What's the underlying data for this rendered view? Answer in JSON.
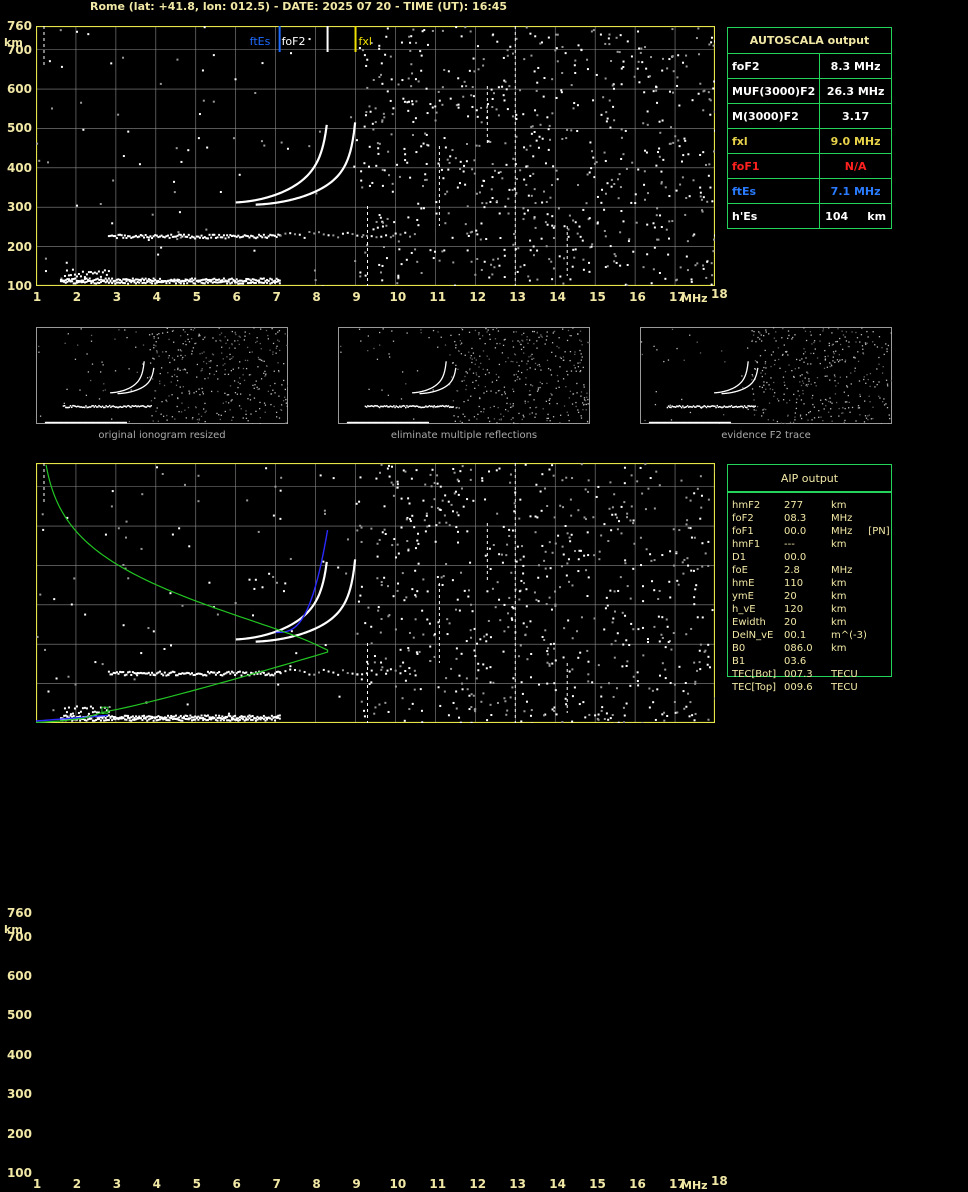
{
  "title": "Rome (lat: +41.8, lon: 012.5) - DATE: 2025 07 20 - TIME (UT): 16:45",
  "axes": {
    "y_unit": "km",
    "x_unit": "MHz",
    "y_ticks": [
      "760",
      "700",
      "600",
      "500",
      "400",
      "300",
      "200",
      "100"
    ],
    "x_ticks": [
      "1",
      "2",
      "3",
      "4",
      "5",
      "6",
      "7",
      "8",
      "9",
      "10",
      "11",
      "12",
      "13",
      "14",
      "15",
      "16",
      "17",
      "18"
    ]
  },
  "markers": {
    "ftEs": "ftEs",
    "foF2": "foF2",
    "fxl": "fxl",
    "ftEs_color": "#1e6bff",
    "foF2_color": "#ffffff",
    "fxl_color": "#f0e000"
  },
  "thumbnails": [
    {
      "caption": "original ionogram resized"
    },
    {
      "caption": "eliminate multiple reflections"
    },
    {
      "caption": "evidence F2 trace"
    }
  ],
  "autoscala": {
    "header": "AUTOSCALA output",
    "rows": [
      {
        "label": "foF2",
        "value": "8.3 MHz",
        "color": "#ffffff"
      },
      {
        "label": "MUF(3000)F2",
        "value": "26.3 MHz",
        "color": "#ffffff"
      },
      {
        "label": "M(3000)F2",
        "value": "3.17",
        "color": "#ffffff"
      },
      {
        "label": "fxl",
        "value": "9.0 MHz",
        "color": "#e8d24a"
      },
      {
        "label": "foF1",
        "value": "N/A",
        "color": "#ff2020"
      },
      {
        "label": "ftEs",
        "value": "7.1 MHz",
        "color": "#2a7bff"
      },
      {
        "label": "h'Es",
        "value": "104     km",
        "color": "#ffffff"
      }
    ]
  },
  "aip": {
    "header": "AIP output",
    "rows": [
      {
        "name": "hmF2",
        "value": "277",
        "unit": "km"
      },
      {
        "name": "foF2",
        "value": "08.3",
        "unit": "MHz"
      },
      {
        "name": "foF1",
        "value": "00.0",
        "unit": "MHz     [PN]"
      },
      {
        "name": "hmF1",
        "value": "---",
        "unit": "km"
      },
      {
        "name": "D1",
        "value": "00.0",
        "unit": ""
      },
      {
        "name": "foE",
        "value": "2.8",
        "unit": "MHz"
      },
      {
        "name": "hmE",
        "value": "110",
        "unit": "km"
      },
      {
        "name": "ymE",
        "value": "20",
        "unit": "km"
      },
      {
        "name": "h_vE",
        "value": "120",
        "unit": "km"
      },
      {
        "name": "Ewidth",
        "value": "20",
        "unit": "km"
      },
      {
        "name": "DelN_vE",
        "value": "00.1",
        "unit": "m^(-3)"
      },
      {
        "name": "B0",
        "value": "086.0",
        "unit": "km"
      },
      {
        "name": "B1",
        "value": "03.6",
        "unit": ""
      },
      {
        "name": "TEC[Bot]",
        "value": "007.3",
        "unit": "TECU"
      },
      {
        "name": "TEC[Top]",
        "value": "009.6",
        "unit": "TECU"
      }
    ]
  }
}
